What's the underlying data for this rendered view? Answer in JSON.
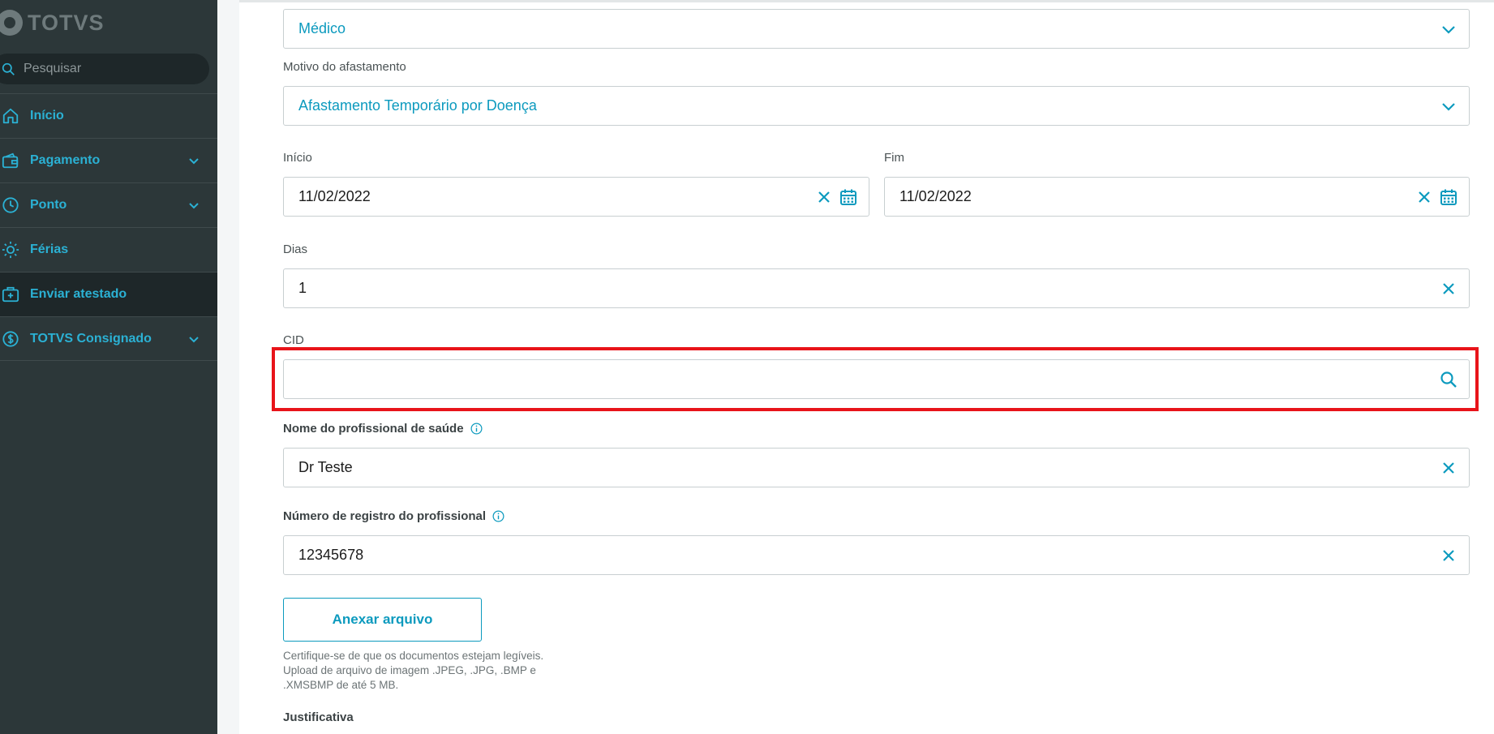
{
  "sidebar": {
    "logo_text": "TOTVS",
    "search_placeholder": "Pesquisar",
    "items": [
      {
        "label": "Início",
        "icon": "home-icon",
        "has_chevron": false,
        "active": false
      },
      {
        "label": "Pagamento",
        "icon": "wallet-icon",
        "has_chevron": true,
        "active": false
      },
      {
        "label": "Ponto",
        "icon": "clock-icon",
        "has_chevron": true,
        "active": false
      },
      {
        "label": "Férias",
        "icon": "sun-icon",
        "has_chevron": false,
        "active": false
      },
      {
        "label": "Enviar atestado",
        "icon": "medical-case-icon",
        "has_chevron": false,
        "active": true
      },
      {
        "label": "TOTVS Consignado",
        "icon": "dollar-circle-icon",
        "has_chevron": true,
        "active": false
      }
    ]
  },
  "form": {
    "tipo_value": "Médico",
    "motivo_label": "Motivo do afastamento",
    "motivo_value": "Afastamento Temporário por Doença",
    "inicio_label": "Início",
    "inicio_value": "11/02/2022",
    "fim_label": "Fim",
    "fim_value": "11/02/2022",
    "dias_label": "Dias",
    "dias_value": "1",
    "cid_label": "CID",
    "cid_value": "",
    "profissional_label": "Nome do profissional de saúde",
    "profissional_value": "Dr Teste",
    "registro_label": "Número de registro do profissional",
    "registro_value": "12345678",
    "attach_label": "Anexar arquivo",
    "help_lines": [
      "Certifique-se de que os documentos estejam legíveis.",
      "Upload de arquivo de imagem .JPEG, .JPG, .BMP e",
      ".XMSBMP de até 5 MB."
    ],
    "justificativa_label": "Justificativa"
  },
  "colors": {
    "sidebar_bg": "#2c3739",
    "accent": "#0c9abe",
    "highlight": "#e8141a"
  }
}
